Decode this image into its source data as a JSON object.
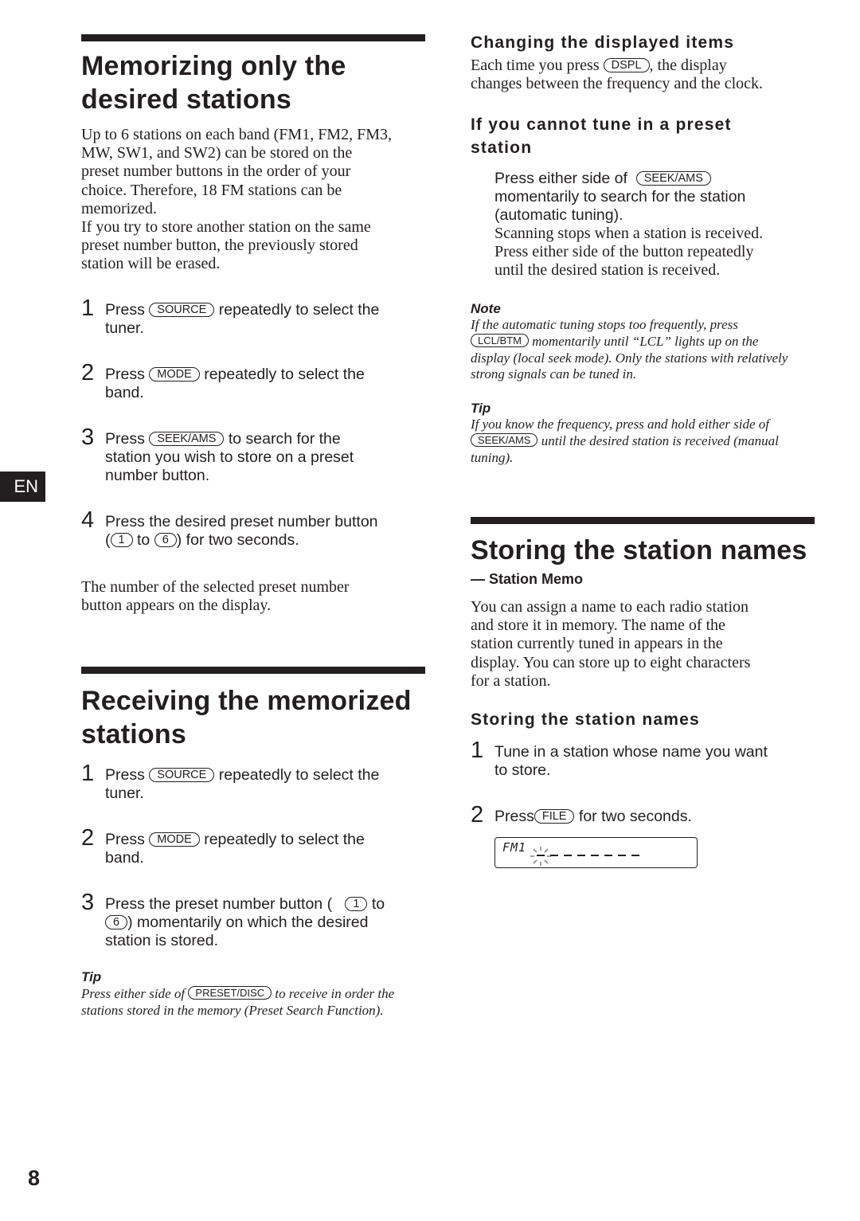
{
  "side_tab": "EN",
  "page_number": "8",
  "left": {
    "memorizing": {
      "title_line1": "Memorizing only the",
      "title_line2": "desired stations",
      "intro_lines": [
        "Up to 6 stations on each band (FM1, FM2, FM3,",
        "MW, SW1, and SW2) can be stored on the",
        "preset number buttons in the order of your",
        "choice. Therefore, 18 FM stations can be",
        "memorized.",
        "If you try to store another station on the same",
        "preset number button, the previously stored",
        "station will be erased."
      ],
      "steps": [
        {
          "num": "1",
          "pre": "Press",
          "key": "SOURCE",
          "post": "repeatedly to select the",
          "line2": "tuner."
        },
        {
          "num": "2",
          "pre": "Press",
          "key": "MODE",
          "post": "repeatedly to select the",
          "line2": "band."
        },
        {
          "num": "3",
          "pre": "Press",
          "key": "SEEK/AMS",
          "post": "to search for the",
          "line2": "station you wish to store on a preset",
          "line3": "number button."
        },
        {
          "num": "4",
          "line1": "Press the desired preset number button",
          "open": "(",
          "key_a": "1",
          "mid": "to",
          "key_b": "6",
          "post": ") for two seconds."
        }
      ],
      "outro_lines": [
        "The number of the selected preset number",
        "button appears on the display."
      ]
    },
    "receiving": {
      "title_line1": "Receiving the memorized",
      "title_line2": "stations",
      "steps": [
        {
          "num": "1",
          "pre": "Press",
          "key": "SOURCE",
          "post": "repeatedly to select the",
          "line2": "tuner."
        },
        {
          "num": "2",
          "pre": "Press",
          "key": "MODE",
          "post": "repeatedly to select the",
          "line2": "band."
        },
        {
          "num": "3",
          "pre": "Press the preset number button (",
          "key_a": "1",
          "mid": "to",
          "key_b": "6",
          "post": ") momentarily on which the desired",
          "line3": "station is stored."
        }
      ],
      "tip": {
        "heading": "Tip",
        "pre": "Press either side of",
        "key": "PRESET/DISC",
        "post": "to receive in order the",
        "line2": "stations stored in the memory (Preset Search Function)."
      }
    }
  },
  "right": {
    "changing": {
      "heading": "Changing the displayed items",
      "pre": "Each time you press",
      "key": "DSPL",
      "post": ", the display",
      "line2": "changes between the frequency and the clock."
    },
    "cannot_tune": {
      "heading_line1": "If you cannot tune in a preset",
      "heading_line2": "station",
      "pre": "Press either side of",
      "key": "SEEK/AMS",
      "line2": "momentarily to search for the station",
      "line3": "(automatic tuning).",
      "serif_lines": [
        "Scanning stops when a station is received.",
        "Press either side of the button repeatedly",
        "until the desired station is received."
      ]
    },
    "note": {
      "heading": "Note",
      "line1": "If the automatic tuning stops too frequently, press",
      "key": "LCL/BTM",
      "line2_post": "momentarily until “LCL” lights up on the",
      "line3": "display (local seek mode). Only the stations with relatively",
      "line4": "strong signals can be tuned in."
    },
    "tip": {
      "heading": "Tip",
      "line1": "If you know the frequency, press and hold either side of",
      "key": "SEEK/AMS",
      "line2_post": "until the desired station is received (manual",
      "line3": "tuning)."
    },
    "storing": {
      "title": "Storing the station names",
      "subtitle": "— Station Memo",
      "intro_lines": [
        "You can assign a name to each radio station",
        "and store it in memory. The name of the",
        "station currently tuned in appears in the",
        "display. You can store up to eight characters",
        "for a station."
      ],
      "subheading": "Storing the station names",
      "steps": [
        {
          "num": "1",
          "line1": "Tune in a station whose name you want",
          "line2": "to store."
        },
        {
          "num": "2",
          "pre": "Press",
          "key": "FILE",
          "post": "for two seconds."
        }
      ],
      "display": {
        "band": "FM1",
        "name_slots": 8,
        "cursor_position": 1
      }
    }
  }
}
